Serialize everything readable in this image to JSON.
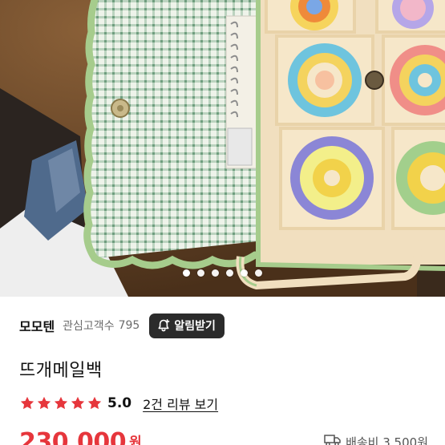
{
  "photo": {
    "alt_subject": "crochet granny square bag",
    "carousel": {
      "count": 6,
      "active_index": 0
    }
  },
  "seller": {
    "name": "모모텐",
    "follow_label": "관심고객수",
    "follow_count": "795",
    "alert_button_label": "알림받기"
  },
  "product": {
    "title": "뜨개메일백",
    "rating": {
      "stars_filled": 5,
      "stars_total": 5,
      "score": "5.0",
      "review_link": "2건 리뷰 보기"
    },
    "price": {
      "amount": "230,000",
      "unit": "원"
    },
    "shipping": {
      "label": "배송비 3,500원"
    }
  },
  "colors": {
    "price": "#e6363c",
    "star": "#e6363c",
    "alert_button_bg": "#2b2b2b"
  },
  "icons": {
    "alert": "bell-plus-icon",
    "shipping": "truck-icon",
    "star": "star-icon"
  }
}
